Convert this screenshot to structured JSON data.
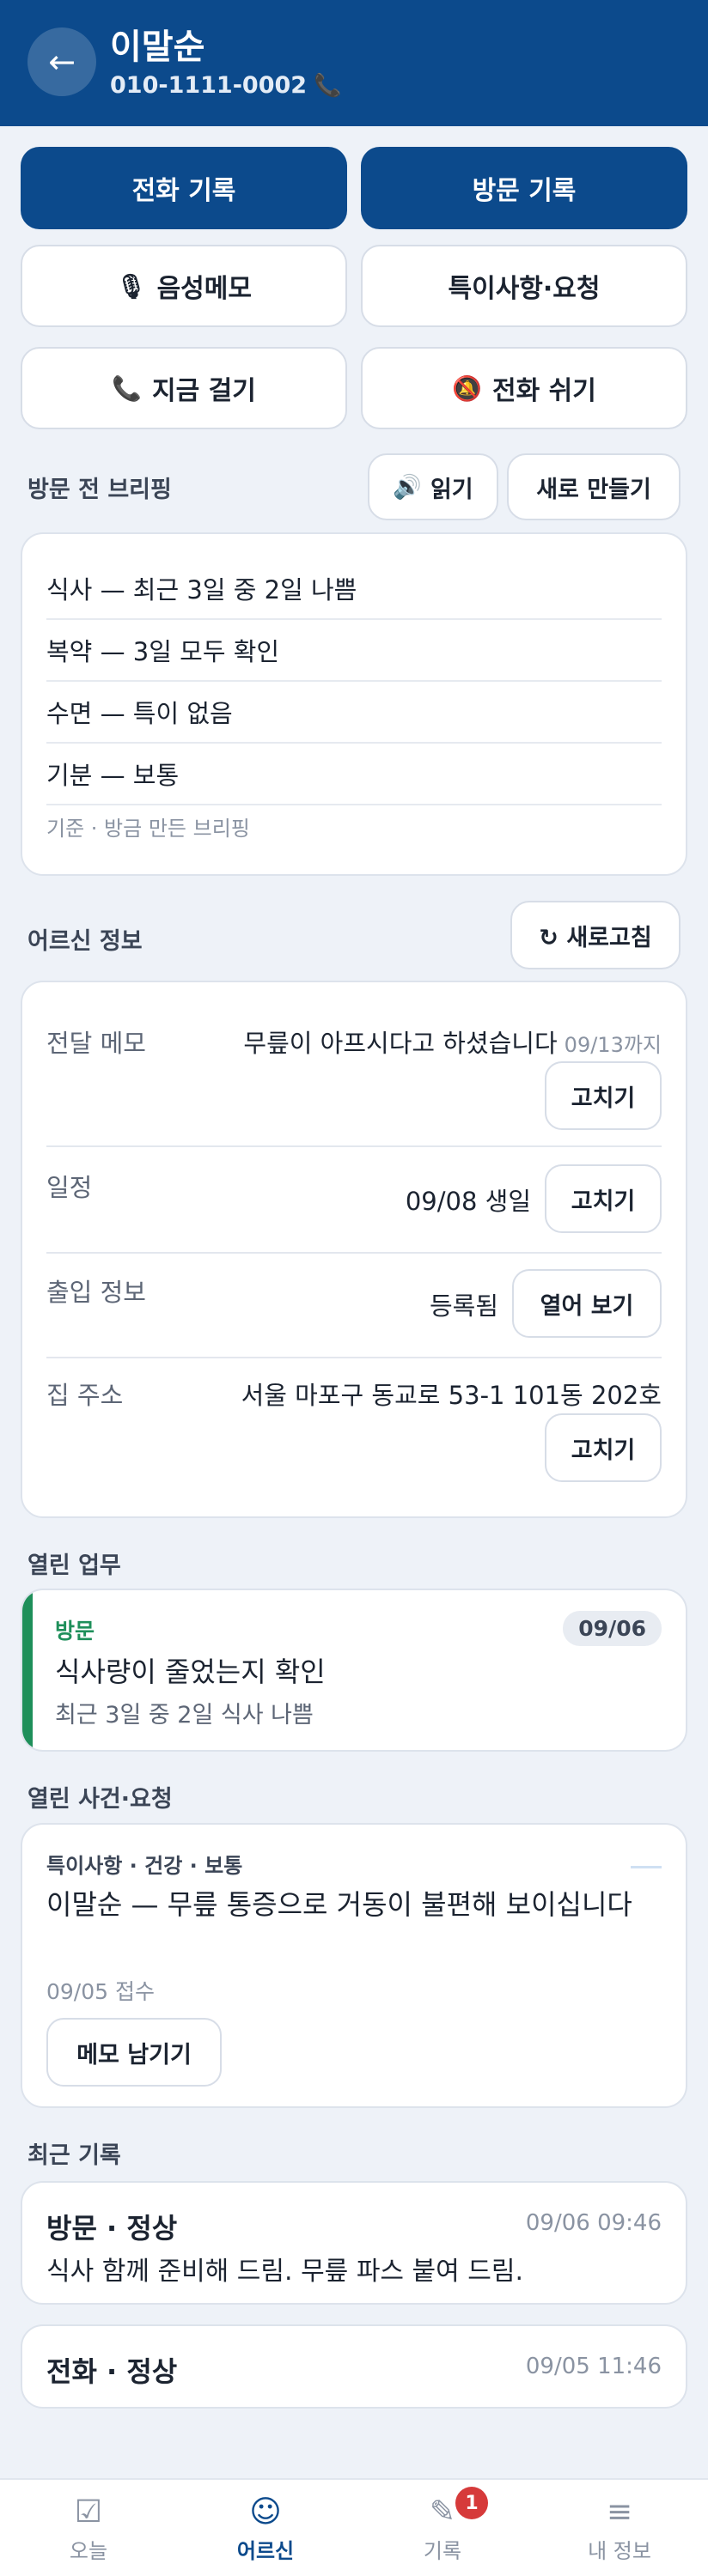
{
  "header": {
    "name": "이말순",
    "phone": "010-1111-0002",
    "phone_icon": "📞",
    "back_icon": "←"
  },
  "actions": {
    "call_log": "전화 기록",
    "visit_log": "방문 기록",
    "voice_memo": "음성메모",
    "voice_memo_icon": "🎙",
    "notes_requests": "특이사항·요청",
    "call_now": "지금 걸기",
    "call_now_icon": "📞",
    "skip_call": "전화 쉬기",
    "skip_call_icon": "🔕"
  },
  "briefing": {
    "title": "방문 전 브리핑",
    "read_label": "읽기",
    "read_icon": "🔊",
    "regenerate_label": "새로 만들기",
    "items": [
      "식사 — 최근 3일 중 2일 나쁨",
      "복약 — 3일 모두 확인",
      "수면 — 특이 없음",
      "기분 — 보통"
    ],
    "footer": "기준 · 방금 만든 브리핑"
  },
  "senior_info": {
    "title": "어르신 정보",
    "refresh_label": "↻ 새로고침",
    "memo_label": "전달 메모",
    "memo_value": "무릎이 아프시다고 하셨습니다",
    "memo_until": "09/13까지",
    "schedule_label": "일정",
    "schedule_value": "09/08 생일",
    "access_label": "출입 정보",
    "access_value": "등록됨",
    "access_button": "열어 보기",
    "address_label": "집 주소",
    "address_value": "서울 마포구 동교로 53-1 101동 202호",
    "edit_label": "고치기"
  },
  "open_tasks": {
    "title": "열린 업무",
    "items": [
      {
        "tag": "방문",
        "date": "09/06",
        "title": "식사량이 줄었는지 확인",
        "detail": "최근 3일 중 2일 식사 나쁨",
        "accent_color": "#1e8f5a"
      }
    ]
  },
  "open_incidents": {
    "title": "열린 사건·요청",
    "items": [
      {
        "tag": "특이사항 · 건강 · 보통",
        "text": "이말순 — 무릎 통증으로 거동이 불편해 보이십니다",
        "date": "09/05 접수",
        "button": "메모 남기기"
      }
    ]
  },
  "recent_records": {
    "title": "최근 기록",
    "items": [
      {
        "title": "방문 · 정상",
        "time": "09/06 09:46",
        "text": "식사 함께 준비해 드림. 무릎 파스 붙여 드림."
      },
      {
        "title": "전화 · 정상",
        "time": "09/05 11:46",
        "text": ""
      }
    ]
  },
  "bottom_nav": {
    "items": [
      {
        "label": "오늘",
        "icon": "☑"
      },
      {
        "label": "어르신",
        "icon": "☺"
      },
      {
        "label": "기록",
        "icon": "✎",
        "badge": "1"
      },
      {
        "label": "내 정보",
        "icon": "≡"
      }
    ],
    "active": "어르신"
  },
  "colors": {
    "primary": "#0c4a8c",
    "task_accent": "#1e8f5a",
    "badge": "#d63a3a",
    "background": "#eef2f8"
  }
}
